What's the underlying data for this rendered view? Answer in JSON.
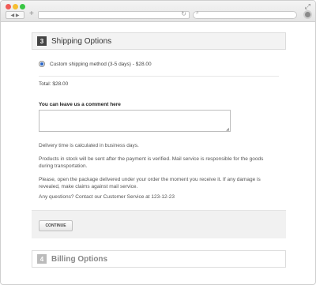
{
  "browser": {
    "nav_arrows": "◀ ▶",
    "new_tab": "+",
    "reload": "↻",
    "search_glyph": "⌕",
    "expand_glyph": "⤢"
  },
  "sections": {
    "shipping": {
      "step": "3",
      "title": "Shipping Options"
    },
    "billing": {
      "step": "4",
      "title": "Billing Options"
    }
  },
  "shipping_option": {
    "label": "Custom shipping method (3-5 days) - $28.00",
    "selected": true
  },
  "total": "Total: $28.00",
  "comment": {
    "label": "You can leave us a comment here",
    "value": ""
  },
  "info": {
    "delivery": "Delivery time is calculated in business days.",
    "stock": "Products in stock will be sent after the payment is verified. Mail service is responsible for the goods during transportation.",
    "damage": "Please, open the package delivered under your order the moment you receive it. If any damage is revealed, make claims against mail service.",
    "questions": "Any questions? Contact our Customer Service at 123-12-23"
  },
  "buttons": {
    "continue": "CONTINUE"
  },
  "colors": {
    "accent": "#2b67c9",
    "badge_active": "#444444",
    "badge_inactive": "#bbbbbb"
  }
}
